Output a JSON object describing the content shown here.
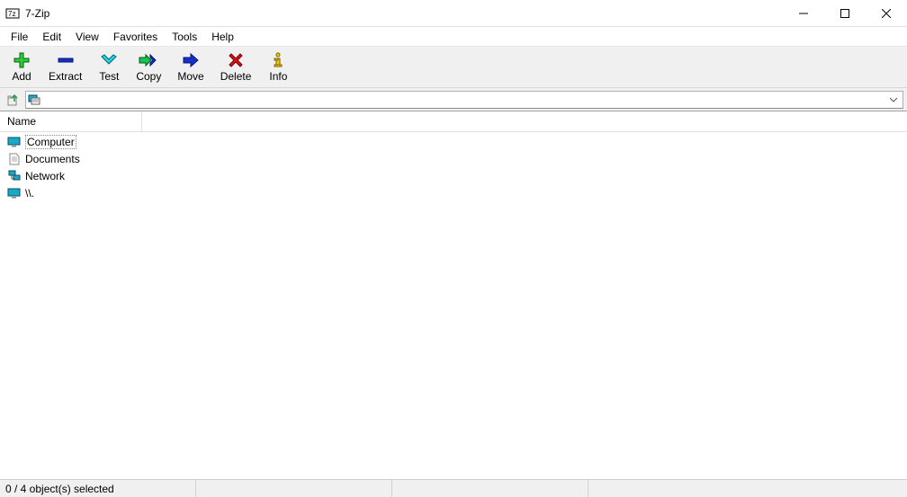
{
  "window": {
    "title": "7-Zip"
  },
  "menu": {
    "file": "File",
    "edit": "Edit",
    "view": "View",
    "favorites": "Favorites",
    "tools": "Tools",
    "help": "Help"
  },
  "toolbar": {
    "add": "Add",
    "extract": "Extract",
    "test": "Test",
    "copy": "Copy",
    "move": "Move",
    "delete": "Delete",
    "info": "Info"
  },
  "address": {
    "value": ""
  },
  "columns": {
    "name": "Name"
  },
  "items": [
    {
      "label": "Computer",
      "icon": "computer"
    },
    {
      "label": "Documents",
      "icon": "document"
    },
    {
      "label": "Network",
      "icon": "network"
    },
    {
      "label": "\\\\.",
      "icon": "monitor"
    }
  ],
  "status": {
    "text": "0 / 4 object(s) selected"
  }
}
